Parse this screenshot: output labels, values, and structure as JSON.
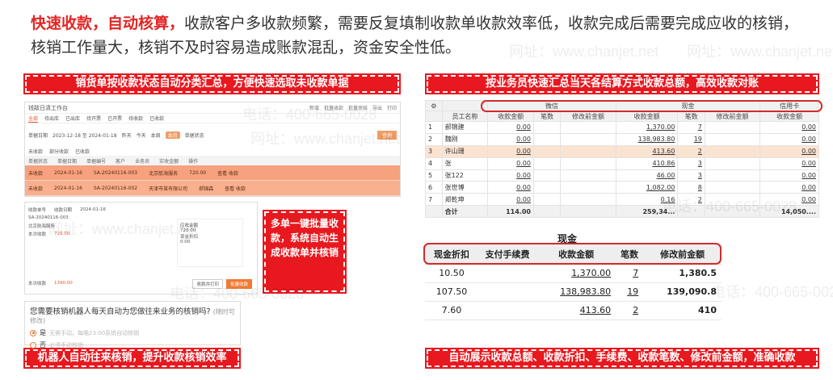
{
  "intro": {
    "highlight1": "快速收款，",
    "highlight2": "自动核算，",
    "text": "收款客户多收款频繁，需要反复填制收款单收款效率低，收款完成后需要完成应收的核销，核销工作量大，核销不及时容易造成账款混乱，资金安全性低。"
  },
  "banners": {
    "left_top": "销货单按收款状态自动分类汇总，方便快速选取未收款单据",
    "right_top": "按业务员快速汇总当天各结算方式收款总额，高效收款对账",
    "left_bottom": "机器人自动往来核销，提升收款核销效率",
    "right_bottom": "自动展示收款总额、收款折扣、手续费、收款笔数、修改前金额，准确收款"
  },
  "callout": "多单一键批量收款，系统自动生成收款单并核销",
  "watermarks": {
    "site": "网址：www.chanjet.net",
    "phone": "电话：400-665-0028"
  },
  "app": {
    "title": "钱敌日清工作台",
    "top_actions": [
      "新增",
      "批量收款",
      "批量审核",
      "导出",
      "打印"
    ],
    "tabs": [
      "全部",
      "待出库",
      "已出库",
      "待开票",
      "已开票",
      "待收款",
      "已收款"
    ],
    "filter_date_label": "单据日期",
    "filter_date_value": "2023-12-18 至 2024-01-18",
    "quick_dates": [
      "昨天",
      "今天",
      "本周",
      "本月"
    ],
    "active_quick": "本月",
    "filter_status_label": "单据状态",
    "search_button": "查询",
    "legend": [
      "未收款",
      "部分收款",
      "已收款"
    ],
    "table_headers": [
      "单据状态",
      "单据日期",
      "单据编号",
      "客户",
      "业务员",
      "实收金额",
      "操作"
    ],
    "rows": [
      {
        "status": "未收款",
        "date": "2024-01-16",
        "code": "SA-20240116-003",
        "customer": "北京航海服务",
        "amount": "720.00",
        "ops": "查看 收款"
      },
      {
        "status": "未收款",
        "date": "2024-01-16",
        "code": "SA-20240116-002",
        "customer": "天津市某有限公司",
        "sales": "郝锦森",
        "amount": "",
        "ops": "查看 收款"
      }
    ]
  },
  "receipt": {
    "code_label": "收款单号",
    "date_label": "收款日期",
    "date_value": "2024-01-16",
    "order": "SA-20240116-003",
    "customer": "北京航海服务",
    "amount_label": "本次收款",
    "amount_value": "720.00",
    "due_label": "应收金额",
    "due_value": "720.00",
    "discount_label": "现金折扣",
    "discount_value": "0.00",
    "total_label": "本次收款",
    "total_value": "1390.00",
    "btn_print": "收款并打印",
    "btn_collect": "批量收款"
  },
  "robot": {
    "question": "您需要核销机器人每天自动为您做往来业务的核销吗?",
    "note": "(随时可修改)",
    "option_yes": "是",
    "option_yes_desc": "无需手动，每晚23:00系统自动核销",
    "option_no": "否",
    "option_no_desc": "必须手动核销"
  },
  "grid": {
    "header_top": [
      "",
      "",
      "微信",
      "现金",
      "信用卡"
    ],
    "headers": [
      "",
      "员工名称",
      "收款金额",
      "笔数",
      "修改前金额",
      "收款金额",
      "笔数",
      "修改前金额",
      "收款金额"
    ],
    "rows": [
      {
        "no": "1",
        "name": "郝锦建",
        "wx_amt": "0.00",
        "wx_cnt": "",
        "wx_pre": "",
        "cash_amt": "1,370.00",
        "cash_cnt": "7",
        "cash_pre": "",
        "card_amt": "0.00",
        "sel": false
      },
      {
        "no": "2",
        "name": "魏刚",
        "wx_amt": "0.00",
        "wx_cnt": "",
        "wx_pre": "",
        "cash_amt": "138,983.80",
        "cash_cnt": "19",
        "cash_pre": "",
        "card_amt": "0.00",
        "sel": false
      },
      {
        "no": "3",
        "name": "许山珊",
        "wx_amt": "0.00",
        "wx_cnt": "",
        "wx_pre": "",
        "cash_amt": "413.60",
        "cash_cnt": "2",
        "cash_pre": "",
        "card_amt": "0.00",
        "sel": true
      },
      {
        "no": "4",
        "name": "张",
        "wx_amt": "0.00",
        "wx_cnt": "",
        "wx_pre": "",
        "cash_amt": "410.86",
        "cash_cnt": "3",
        "cash_pre": "",
        "card_amt": "0.00",
        "sel": false
      },
      {
        "no": "5",
        "name": "张122",
        "wx_amt": "0.00",
        "wx_cnt": "",
        "wx_pre": "",
        "cash_amt": "46.00",
        "cash_cnt": "3",
        "cash_pre": "",
        "card_amt": "0.00",
        "sel": false
      },
      {
        "no": "6",
        "name": "张世博",
        "wx_amt": "0.00",
        "wx_cnt": "",
        "wx_pre": "",
        "cash_amt": "1,082.00",
        "cash_cnt": "8",
        "cash_pre": "",
        "card_amt": "0.00",
        "sel": false
      },
      {
        "no": "7",
        "name": "郑乾坤",
        "wx_amt": "0.00",
        "wx_cnt": "",
        "wx_pre": "",
        "cash_amt": "0.16",
        "cash_cnt": "2",
        "cash_pre": "",
        "card_amt": "0.00",
        "sel": false
      }
    ],
    "total": {
      "label": "合计",
      "wx_amt": "114.00",
      "cash_amt": "259,34...",
      "card_amt": "14,050...."
    }
  },
  "cash": {
    "title": "现金",
    "headers": [
      "现金折扣",
      "支付手续费",
      "收款金额",
      "笔数",
      "修改前金额"
    ],
    "rows": [
      {
        "discount": "10.50",
        "fee": "",
        "amount": "1,370.00",
        "count": "7",
        "pre": "1,380.5"
      },
      {
        "discount": "107.50",
        "fee": "",
        "amount": "138,983.80",
        "count": "19",
        "pre": "139,090.8"
      },
      {
        "discount": "7.60",
        "fee": "",
        "amount": "413.60",
        "count": "2",
        "pre": "410"
      }
    ]
  },
  "colors": {
    "brand_red": "#e8181f",
    "orange": "#f07a35",
    "row_highlight": "#f7a27e"
  }
}
